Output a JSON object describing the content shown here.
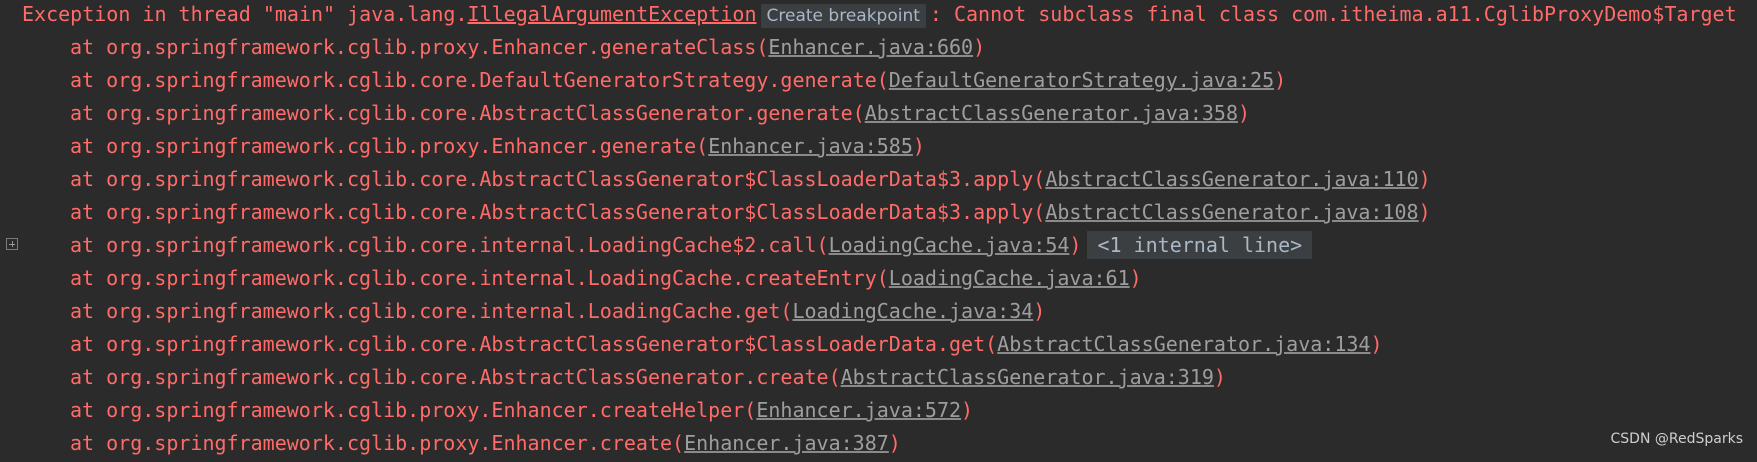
{
  "exception": {
    "prefix": "Exception in thread \"main\" java.lang.",
    "class_link": "IllegalArgumentException",
    "breakpoint_label": "Create breakpoint",
    "message": ": Cannot subclass final class com.itheima.a11.CglibProxyDemo$Target"
  },
  "frames": [
    {
      "method": "at org.springframework.cglib.proxy.Enhancer.generateClass(",
      "source": "Enhancer.java:660",
      "suffix": ")"
    },
    {
      "method": "at org.springframework.cglib.core.DefaultGeneratorStrategy.generate(",
      "source": "DefaultGeneratorStrategy.java:25",
      "suffix": ")"
    },
    {
      "method": "at org.springframework.cglib.core.AbstractClassGenerator.generate(",
      "source": "AbstractClassGenerator.java:358",
      "suffix": ")"
    },
    {
      "method": "at org.springframework.cglib.proxy.Enhancer.generate(",
      "source": "Enhancer.java:585",
      "suffix": ")"
    },
    {
      "method": "at org.springframework.cglib.core.AbstractClassGenerator$ClassLoaderData$3.apply(",
      "source": "AbstractClassGenerator.java:110",
      "suffix": ")"
    },
    {
      "method": "at org.springframework.cglib.core.AbstractClassGenerator$ClassLoaderData$3.apply(",
      "source": "AbstractClassGenerator.java:108",
      "suffix": ")"
    },
    {
      "method": "at org.springframework.cglib.core.internal.LoadingCache$2.call(",
      "source": "LoadingCache.java:54",
      "suffix": ")",
      "internal": "<1 internal line>"
    },
    {
      "method": "at org.springframework.cglib.core.internal.LoadingCache.createEntry(",
      "source": "LoadingCache.java:61",
      "suffix": ")"
    },
    {
      "method": "at org.springframework.cglib.core.internal.LoadingCache.get(",
      "source": "LoadingCache.java:34",
      "suffix": ")"
    },
    {
      "method": "at org.springframework.cglib.core.AbstractClassGenerator$ClassLoaderData.get(",
      "source": "AbstractClassGenerator.java:134",
      "suffix": ")"
    },
    {
      "method": "at org.springframework.cglib.core.AbstractClassGenerator.create(",
      "source": "AbstractClassGenerator.java:319",
      "suffix": ")"
    },
    {
      "method": "at org.springframework.cglib.proxy.Enhancer.createHelper(",
      "source": "Enhancer.java:572",
      "suffix": ")"
    },
    {
      "method": "at org.springframework.cglib.proxy.Enhancer.create(",
      "source": "Enhancer.java:387",
      "suffix": ")"
    }
  ],
  "watermark": "CSDN @RedSparks",
  "colors": {
    "background": "#2b2b2b",
    "error_text": "#ff6b68",
    "link_text": "#9e9e9e"
  }
}
